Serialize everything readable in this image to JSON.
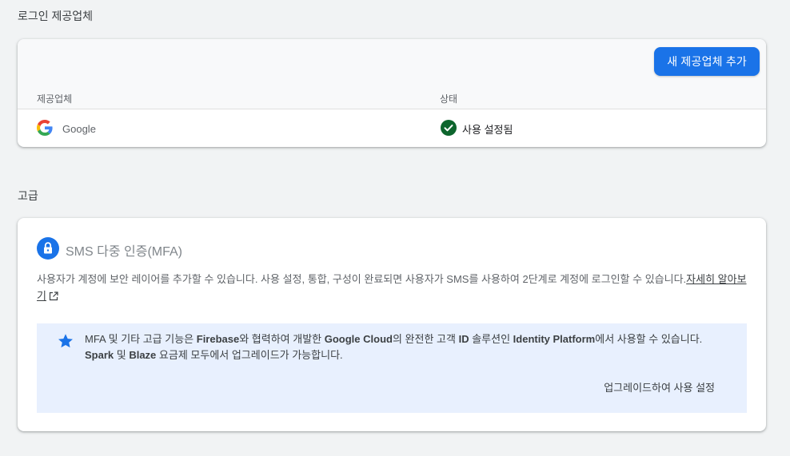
{
  "login_providers": {
    "section_title": "로그인 제공업체",
    "add_button_label": "새 제공업체 추가",
    "columns": {
      "provider": "제공업체",
      "status": "상태"
    },
    "rows": [
      {
        "provider": "Google",
        "status": "사용 설정됨"
      }
    ]
  },
  "advanced": {
    "section_title": "고급",
    "mfa_title": "SMS 다중 인증(MFA)",
    "description": "사용자가 계정에 보안 레이어를 추가할 수 있습니다. 사용 설정, 통합, 구성이 완료되면 사용자가 SMS를 사용하여 2단계로 계정에 로그인할 수 있습니다.",
    "learn_more_label": "자세히 알아보기",
    "promo": {
      "t1": "MFA 및 기타 고급 기능은 ",
      "b1": "Firebase",
      "t2": "와 협력하여 개발한 ",
      "b2": "Google Cloud",
      "t3": "의 완전한 고객 ",
      "b3": "ID",
      "t4": " 솔루션인 ",
      "b4": "Identity Platform",
      "t5": "에서 사용할 수 있습니다. ",
      "b5": "Spark",
      "t6": " 및 ",
      "b6": "Blaze",
      "t7": " 요금제 모두에서 업그레이드가 가능합니다.",
      "upgrade_label": "업그레이드하여 사용 설정"
    }
  },
  "colors": {
    "primary": "#1a73e8",
    "status_ok": "#0d652d",
    "promo_bg": "#e8f0fe"
  },
  "icons": [
    "google-logo",
    "check-circle-icon",
    "lock-icon",
    "external-link-icon",
    "star-icon"
  ]
}
